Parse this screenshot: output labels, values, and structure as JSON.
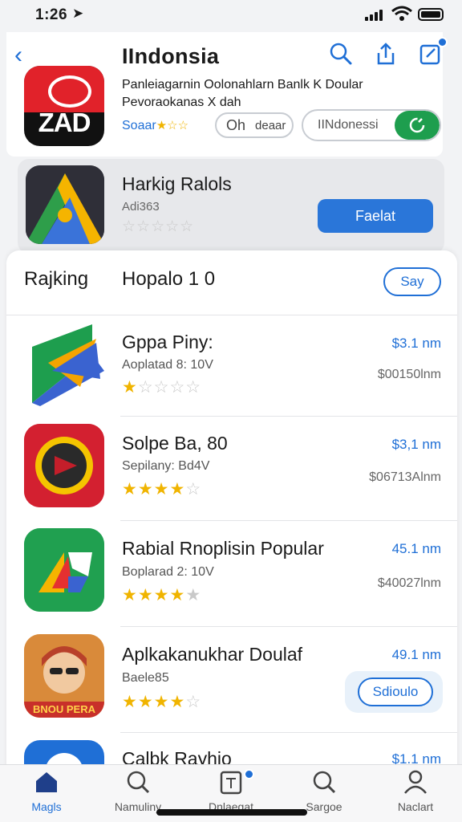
{
  "status_bar": {
    "time": "1:26",
    "location_glyph": "➤"
  },
  "header": {
    "title": "IIndonsia",
    "back_glyph": "‹",
    "featured": {
      "icon_text": "ZAD",
      "description_line1": "Panleiagarnin Oolonahlarn Banlk K Doular",
      "description_line2": "Pevoraokanas  X dah",
      "rating_label": "Soaar",
      "chip_letter": "Oh",
      "chip_text": "deaar",
      "search_value": "IINdonessi"
    }
  },
  "promoted": {
    "name": "Harkig Ralols",
    "subtitle": "Adi363",
    "stars": "☆☆☆☆☆",
    "button_label": "Faelat"
  },
  "ranking": {
    "label": "Rajking",
    "title": "Hopalo 1 0",
    "see_all": "Say",
    "items": [
      {
        "name": "Gppa Piny:",
        "subtitle": "Aoplatad 8: 10V",
        "rating": 1,
        "price": "$3.1 nm",
        "size": "$00150lnm"
      },
      {
        "name": "Solpe Ba, 80",
        "subtitle": "Sepilany: Bd4V",
        "rating": 4,
        "price": "$3,1 nm",
        "size": "$06713Alnm"
      },
      {
        "name": "Rabial Rnoplisin Popular",
        "subtitle": "Boplarad 2: 10V",
        "rating": 4,
        "price": "45.1 nm",
        "size": "$40027lnm"
      },
      {
        "name": "Aplkakanukhar Doulaf",
        "subtitle": "Baele85",
        "rating": 4,
        "price": "49.1 nm",
        "size": ""
      },
      {
        "name": "Calbk Rayhio",
        "subtitle": "",
        "rating": 0,
        "price": "$1.1 nm",
        "size": ""
      }
    ],
    "item4_button": "Sdioulo",
    "item4_icon_text": "BNOU PERA"
  },
  "tabs": [
    {
      "label": "Magls",
      "icon": "home-icon",
      "active": true
    },
    {
      "label": "Namuliny",
      "icon": "search-icon",
      "active": false
    },
    {
      "label": "Dnlaegat",
      "icon": "updates-icon",
      "active": false
    },
    {
      "label": "Sargoe",
      "icon": "search-icon",
      "active": false
    },
    {
      "label": "Naclart",
      "icon": "person-icon",
      "active": false
    }
  ],
  "colors": {
    "accent": "#1f6fd6",
    "green": "#1e9e4e",
    "star": "#f0b400"
  }
}
